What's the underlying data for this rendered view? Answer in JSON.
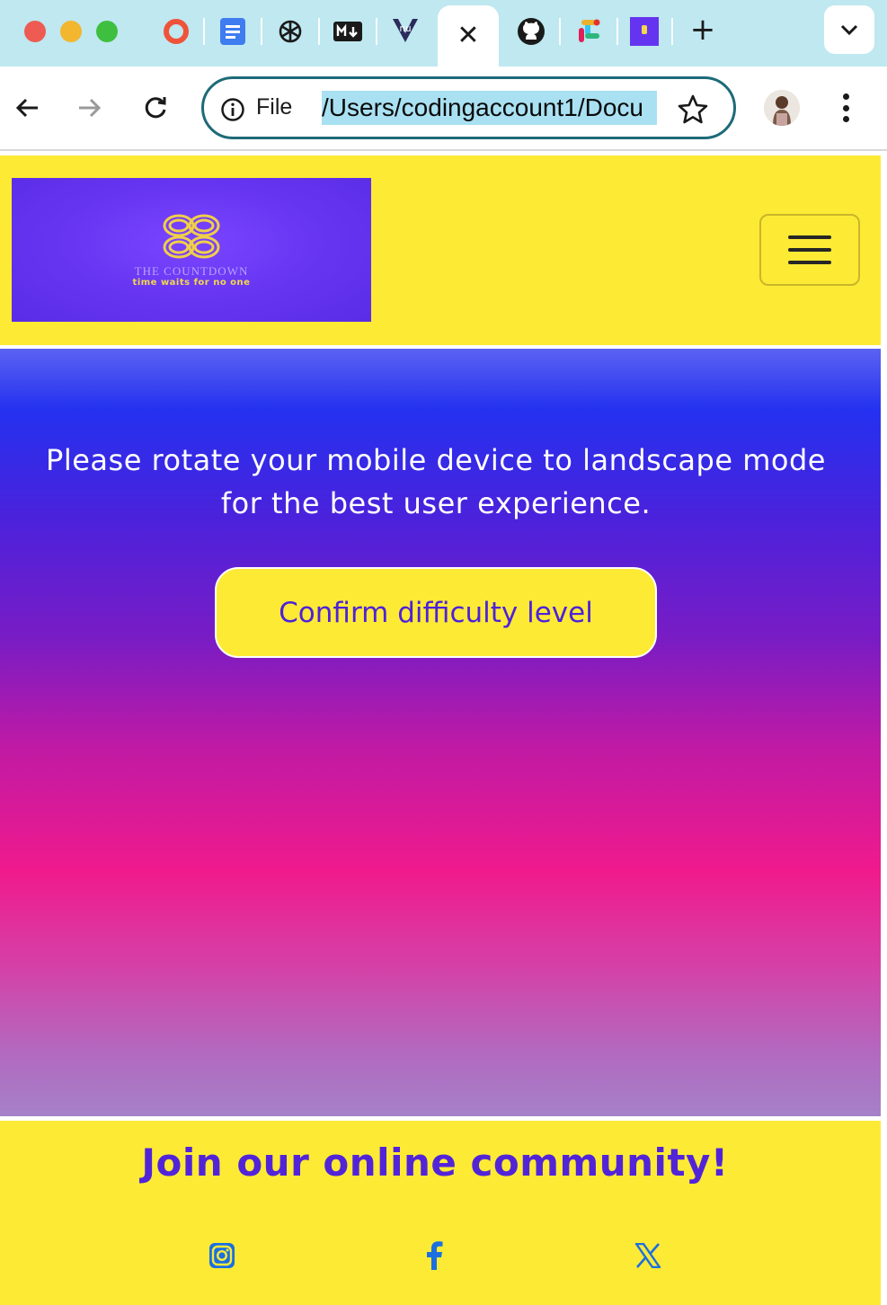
{
  "browser": {
    "tabs": [
      {
        "icon": "opera-icon"
      },
      {
        "icon": "google-docs-icon"
      },
      {
        "icon": "chatgpt-icon"
      },
      {
        "icon": "markdown-icon"
      },
      {
        "icon": "nu-validator-icon"
      },
      {
        "icon": "close-icon",
        "active": true
      },
      {
        "icon": "github-icon"
      },
      {
        "icon": "slack-icon"
      },
      {
        "icon": "countdown-site-icon"
      }
    ],
    "new_tab_label": "+",
    "address_bar": {
      "scheme_label": "File",
      "url": "/Users/codingaccount1/Docu"
    }
  },
  "site": {
    "logo": {
      "name": "THE COUNTDOWN",
      "tagline": "time waits for no one"
    },
    "hero": {
      "message": "Please rotate your mobile device to landscape mode for the best user experience.",
      "button_label": "Confirm difficulty level"
    },
    "footer": {
      "title": "Join our online community!",
      "social_links": [
        "instagram-icon",
        "facebook-icon",
        "x-twitter-icon"
      ]
    }
  },
  "colors": {
    "header_bg": "#fdea35",
    "accent_purple": "#5224d8",
    "omnibox_border": "#1d6a78",
    "url_highlight": "#a9e1f2"
  }
}
